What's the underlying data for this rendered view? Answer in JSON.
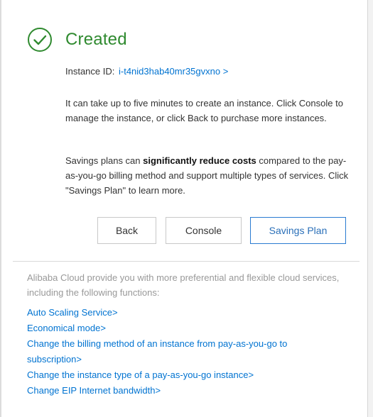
{
  "dialog": {
    "title": "Created",
    "instance_label": "Instance ID:",
    "instance_id_link": "i-t4nid3hab40mr35gvxno >",
    "paragraph1": "It can take up to five minutes to create an instance. Click Console to manage the instance, or click Back to purchase more instances.",
    "paragraph2_before": "Savings plans can ",
    "paragraph2_bold": "significantly reduce costs",
    "paragraph2_after": " compared to the pay-as-you-go billing method and support multiple types of services. Click \"Savings Plan\" to learn more.",
    "buttons": {
      "back": "Back",
      "console": "Console",
      "savings_plan": "Savings Plan"
    },
    "more_text": "Alibaba Cloud provide you with more preferential and flexible cloud services, including the following functions:",
    "links": [
      "Auto Scaling Service>",
      "Economical mode>",
      "Change the billing method of an instance from pay-as-you-go to subscription>",
      "Change the instance type of a pay-as-you-go instance>",
      "Change EIP Internet bandwidth>"
    ]
  },
  "colors": {
    "success_green": "#2f8a2f",
    "link_blue": "#0073d1",
    "primary_border": "#2a7bd1"
  },
  "icons": {
    "status": "check-circle-icon"
  }
}
